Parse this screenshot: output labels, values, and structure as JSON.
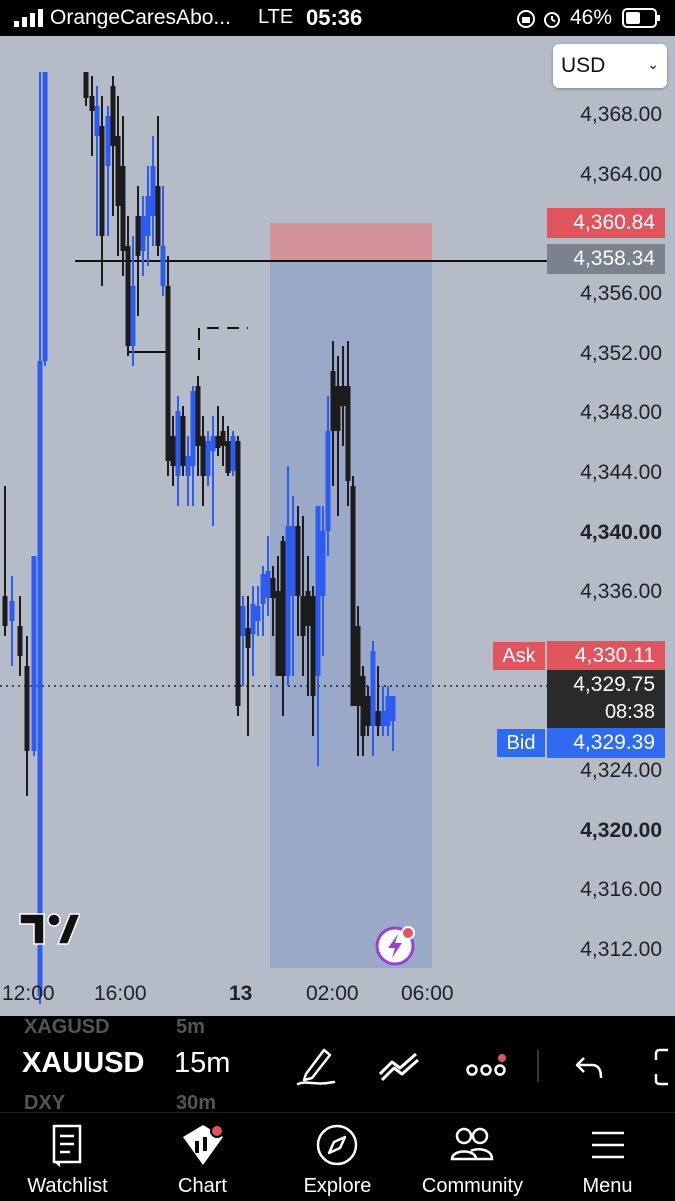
{
  "status_bar": {
    "carrier": "OrangeCaresAbo...",
    "network": "LTE",
    "time": "05:36",
    "battery": "46%"
  },
  "currency": "USD",
  "price_axis": [
    "4,368.00",
    "4,364.00",
    "4,356.00",
    "4,352.00",
    "4,348.00",
    "4,344.00",
    "4,340.00",
    "4,336.00",
    "4,324.00",
    "4,320.00",
    "4,316.00",
    "4,312.00"
  ],
  "price_axis_bold": [
    "4,340.00",
    "4,320.00"
  ],
  "tags": {
    "stop_price": "4,360.84",
    "entry_price": "4,358.34",
    "ask_label": "Ask",
    "ask_price": "4,330.11",
    "last_price": "4,329.75",
    "countdown": "08:38",
    "bid_label": "Bid",
    "bid_price": "4,329.39"
  },
  "time_axis": [
    "12:00",
    "16:00",
    "13",
    "02:00",
    "06:00"
  ],
  "toolbar": {
    "symbol": "XAUUSD",
    "interval": "15m",
    "ghost_symbol_above": "XAGUSD",
    "ghost_interval_above": "5m",
    "ghost_symbol_below": "DXY",
    "ghost_interval_below": "30m"
  },
  "nav": [
    {
      "label": "Watchlist",
      "icon": "watchlist-icon"
    },
    {
      "label": "Chart",
      "icon": "chart-icon"
    },
    {
      "label": "Explore",
      "icon": "compass-icon"
    },
    {
      "label": "Community",
      "icon": "community-icon"
    },
    {
      "label": "Menu",
      "icon": "menu-icon"
    }
  ],
  "colors": {
    "up_candle": "#2f5cf0",
    "down_candle": "#1c1c1c",
    "ask": "#e0545d",
    "bid": "#2f6bf0",
    "chart_bg": "#b6bcc7"
  }
}
